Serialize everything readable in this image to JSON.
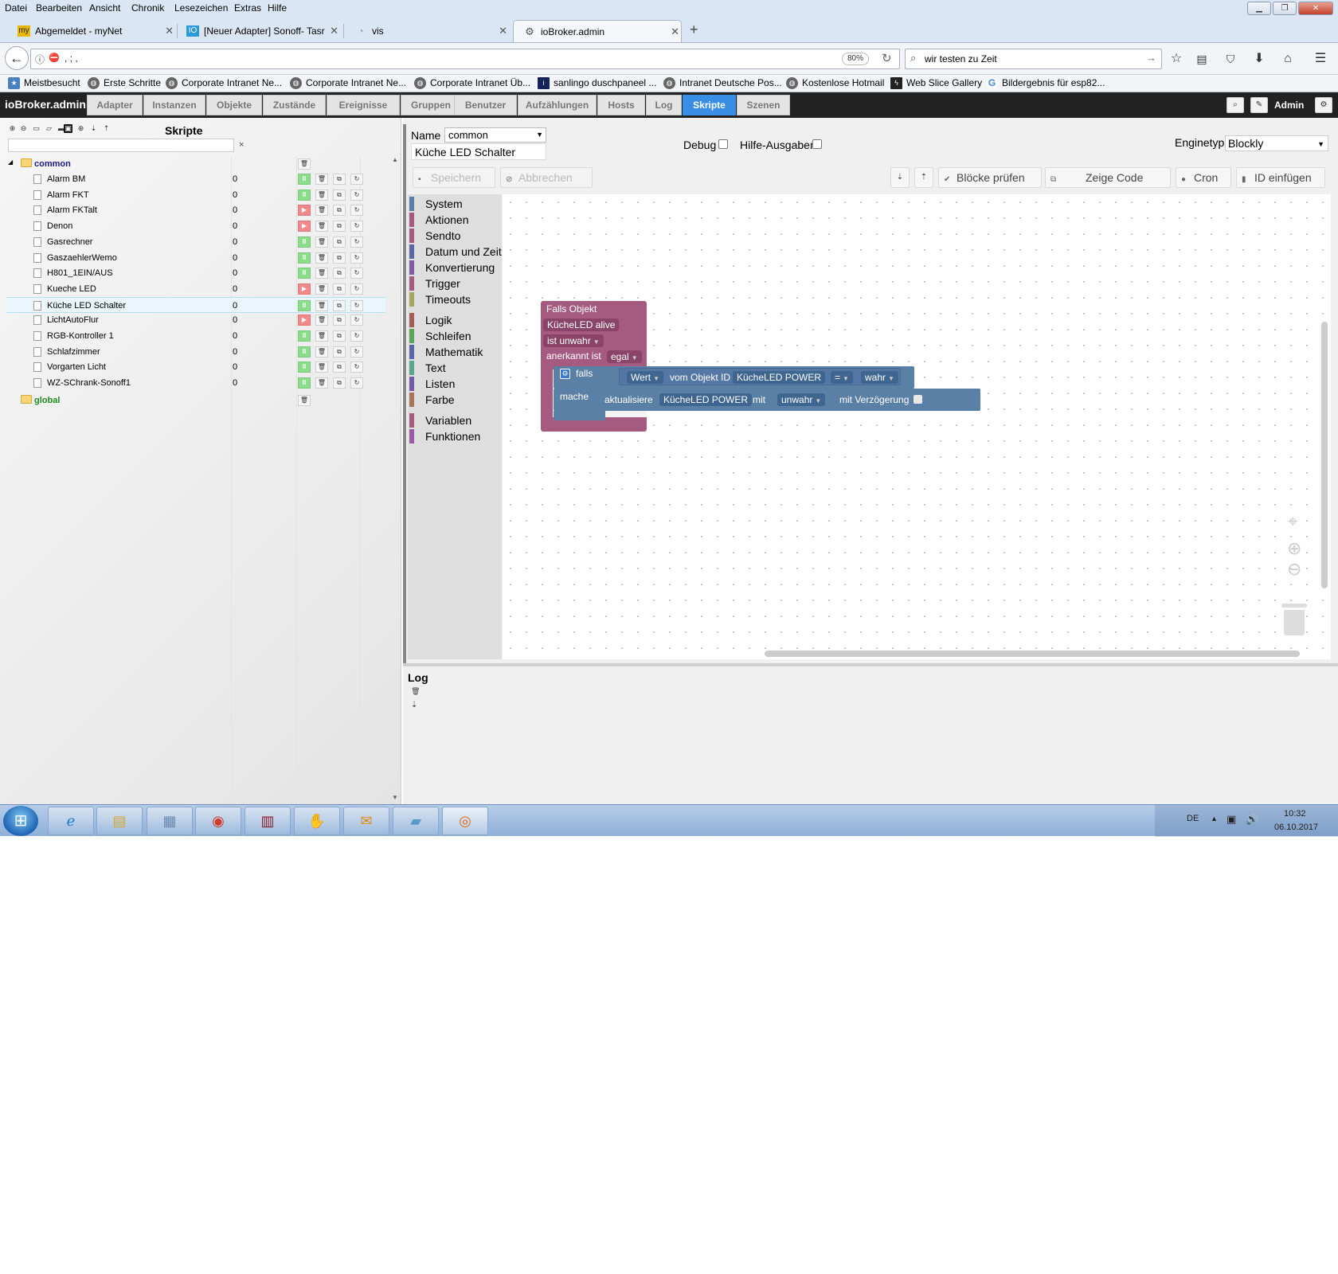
{
  "browser": {
    "menu": [
      "Datei",
      "Bearbeiten",
      "Ansicht",
      "Chronik",
      "Lesezeichen",
      "Extras",
      "Hilfe"
    ],
    "tabs": [
      {
        "title": "Abgemeldet - myNet",
        "icon": "mynet-icon"
      },
      {
        "title": "[Neuer Adapter] Sonoff- Tasr",
        "icon": "iobroker-forum-icon"
      },
      {
        "title": "vis",
        "icon": "vis-icon"
      },
      {
        "title": "ioBroker.admin",
        "icon": "iobroker-icon"
      }
    ],
    "new_tab_label": "+",
    "url": ",          ;       ,",
    "zoom": "80%",
    "search_value": "wir testen zu Zeit",
    "bookmarks": [
      "Meistbesucht",
      "Erste Schritte",
      "Corporate Intranet Ne...",
      "Corporate Intranet Ne...",
      "Corporate Intranet Üb...",
      "sanlingo duschpaneel ...",
      "Intranet Deutsche Pos...",
      "Kostenlose Hotmail",
      "Web Slice Gallery",
      "Bildergebnis für esp82..."
    ]
  },
  "app": {
    "brand": "ioBroker.admin",
    "tabs": [
      "Adapter",
      "Instanzen",
      "Objekte",
      "Zustände",
      "Ereignisse",
      "Gruppen",
      "Benutzer",
      "Aufzählungen",
      "Hosts",
      "Log",
      "Skripte",
      "Szenen"
    ],
    "active_tab": "Skripte",
    "user": "Admin"
  },
  "scripts_panel": {
    "title": "Skripte",
    "filter_value": "",
    "filter_clear": "×",
    "folders": [
      {
        "name": "common",
        "color": "#1a1a80"
      },
      {
        "name": "global",
        "color": "#1e8a1e"
      }
    ],
    "scripts": [
      {
        "name": "Alarm BM",
        "count": "0",
        "running": true
      },
      {
        "name": "Alarm FKT",
        "count": "0",
        "running": true
      },
      {
        "name": "Alarm FKTalt",
        "count": "0",
        "running": false
      },
      {
        "name": "Denon",
        "count": "0",
        "running": false
      },
      {
        "name": "Gasrechner",
        "count": "0",
        "running": true
      },
      {
        "name": "GaszaehlerWemo",
        "count": "0",
        "running": true
      },
      {
        "name": "H801_1EIN/AUS",
        "count": "0",
        "running": true
      },
      {
        "name": "Kueche LED",
        "count": "0",
        "running": false
      },
      {
        "name": "Küche LED Schalter",
        "count": "0",
        "running": true
      },
      {
        "name": "LichtAutoFlur",
        "count": "0",
        "running": false
      },
      {
        "name": "RGB-Kontroller 1",
        "count": "0",
        "running": true
      },
      {
        "name": "Schlafzimmer",
        "count": "0",
        "running": true
      },
      {
        "name": "Vorgarten Licht",
        "count": "0",
        "running": true
      },
      {
        "name": "WZ-SChrank-Sonoff1",
        "count": "0",
        "running": true
      }
    ]
  },
  "editor": {
    "name_label": "Name",
    "folder_value": "common",
    "script_name": "Küche LED Schalter",
    "debug_label": "Debug",
    "help_label": "Hilfe-Ausgaben",
    "engine_label": "Enginetyp",
    "engine_value": "Blockly",
    "save_label": "Speichern",
    "cancel_label": "Abbrechen",
    "check_label": "Blöcke prüfen",
    "show_code_label": "Zeige Code",
    "cron_label": "Cron",
    "insert_id_label": "ID einfügen"
  },
  "toolbox": {
    "categories": [
      {
        "label": "System",
        "color": "#5b80a5"
      },
      {
        "label": "Aktionen",
        "color": "#a55b80"
      },
      {
        "label": "Sendto",
        "color": "#a55b80"
      },
      {
        "label": "Datum und Zeit",
        "color": "#5b67a5"
      },
      {
        "label": "Konvertierung",
        "color": "#805ba5"
      },
      {
        "label": "Trigger",
        "color": "#a55b80"
      },
      {
        "label": "Timeouts",
        "color": "#a5a55b"
      },
      {
        "label": "Logik",
        "color": "#a55b5b"
      },
      {
        "label": "Schleifen",
        "color": "#5ba55b"
      },
      {
        "label": "Mathematik",
        "color": "#5b67a5"
      },
      {
        "label": "Text",
        "color": "#5ba58c"
      },
      {
        "label": "Listen",
        "color": "#745ba5"
      },
      {
        "label": "Farbe",
        "color": "#a5745b"
      },
      {
        "label": "Variablen",
        "color": "#a55b80"
      },
      {
        "label": "Funktionen",
        "color": "#995ba5"
      }
    ]
  },
  "blocks": {
    "trigger_title": "Falls Objekt",
    "trigger_object": "KücheLED alive",
    "trigger_condition": "ist unwahr",
    "ack_label": "anerkannt ist",
    "ack_value": "egal",
    "if_label": "falls",
    "do_label": "mache",
    "value_label": "Wert",
    "from_object_label": "vom Objekt ID",
    "compare_object": "KücheLED POWER",
    "operator": "=",
    "compare_value": "wahr",
    "update_label": "aktualisiere",
    "update_object": "KücheLED POWER",
    "with_label": "mit",
    "update_value": "unwahr",
    "delay_label": "mit Verzögerung",
    "trigger_color": "#a55b80",
    "logic_color": "#5b80a5"
  },
  "log": {
    "title": "Log"
  },
  "taskbar": {
    "language": "DE",
    "time": "10:32",
    "date": "06.10.2017"
  }
}
